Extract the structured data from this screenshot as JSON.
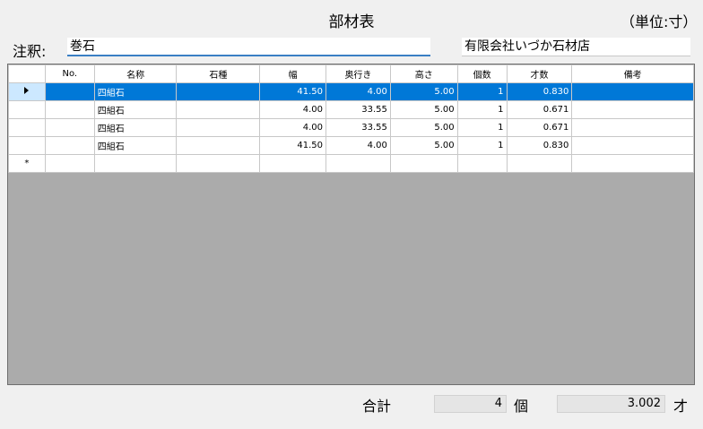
{
  "header": {
    "title": "部材表",
    "unit": "（単位:寸）"
  },
  "order": {
    "label": "注釈:",
    "value": "巻石"
  },
  "company": {
    "value": "有限会社いづか石材店"
  },
  "table": {
    "columns": [
      "No.",
      "名称",
      "石種",
      "幅",
      "奥行き",
      "高さ",
      "個数",
      "才数",
      "備考"
    ],
    "rows": [
      {
        "no": "",
        "name": "四組石",
        "stone": "",
        "width": "41.50",
        "depth": "4.00",
        "height": "5.00",
        "count": "1",
        "sai": "0.830",
        "note": "",
        "selected": true
      },
      {
        "no": "",
        "name": "四組石",
        "stone": "",
        "width": "4.00",
        "depth": "33.55",
        "height": "5.00",
        "count": "1",
        "sai": "0.671",
        "note": ""
      },
      {
        "no": "",
        "name": "四組石",
        "stone": "",
        "width": "4.00",
        "depth": "33.55",
        "height": "5.00",
        "count": "1",
        "sai": "0.671",
        "note": ""
      },
      {
        "no": "",
        "name": "四組石",
        "stone": "",
        "width": "41.50",
        "depth": "4.00",
        "height": "5.00",
        "count": "1",
        "sai": "0.830",
        "note": ""
      }
    ],
    "new_row_marker": "*"
  },
  "footer": {
    "total_label": "合計",
    "count_value": "4",
    "count_unit": "個",
    "sai_value": "3.002",
    "sai_unit": "才"
  }
}
